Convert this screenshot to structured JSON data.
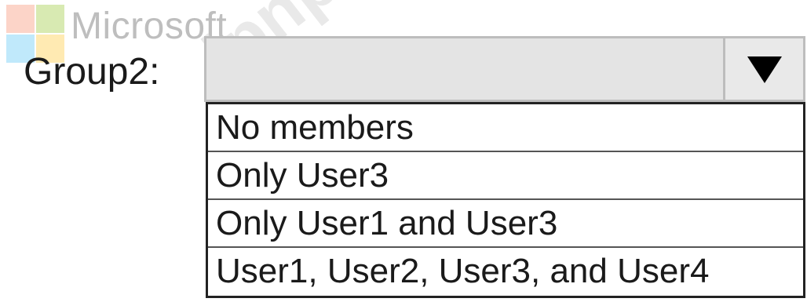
{
  "logo": {
    "wordmark": "Microsoft"
  },
  "watermark": {
    "text": "ipnpdf"
  },
  "field": {
    "label": "Group2:",
    "selected_value": ""
  },
  "icons": {
    "dropdown_arrow": "triangle-down-icon"
  },
  "options": [
    {
      "label": "No members"
    },
    {
      "label": "Only User3"
    },
    {
      "label": "Only User1 and User3"
    },
    {
      "label": "User1, User2, User3, and User4"
    }
  ]
}
